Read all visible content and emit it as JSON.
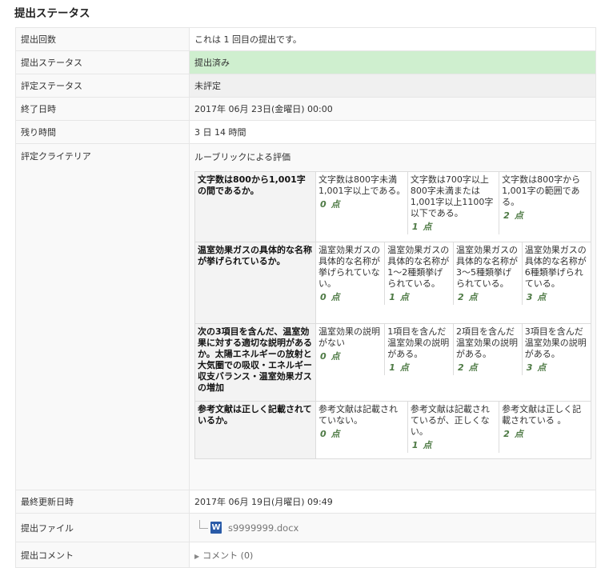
{
  "heading": "提出ステータス",
  "rows": {
    "attempt": {
      "label": "提出回数",
      "value": "これは 1 回目の提出です。"
    },
    "submission_status": {
      "label": "提出ステータス",
      "value": "提出済み"
    },
    "grading_status": {
      "label": "評定ステータス",
      "value": "未評定"
    },
    "due_date": {
      "label": "終了日時",
      "value": "2017年 06月 23日(金曜日) 00:00"
    },
    "time_remaining": {
      "label": "残り時間",
      "value": "3 日 14 時間"
    },
    "criteria": {
      "label": "評定クライテリア",
      "method": "ルーブリックによる評価"
    },
    "last_modified": {
      "label": "最終更新日時",
      "value": "2017年 06月 19日(月曜日) 09:49"
    },
    "files": {
      "label": "提出ファイル",
      "filename": "s9999999.docx"
    },
    "comments": {
      "label": "提出コメント",
      "toggle": "コメント (0)"
    }
  },
  "rubric": {
    "point_unit": "点",
    "criteria": [
      {
        "description": "文字数は800から1,001字の間であるか。",
        "levels": [
          {
            "definition": "文字数は800字未満1,001字以上である。",
            "score": "0"
          },
          {
            "definition": "文字数は700字以上800字未満または1,001字以上1100字以下である。",
            "score": "1"
          },
          {
            "definition": "文字数は800字から1,001字の範囲である。",
            "score": "2"
          }
        ]
      },
      {
        "description": "温室効果ガスの具体的な名称が挙げられているか。",
        "levels": [
          {
            "definition": "温室効果ガスの具体的な名称が挙げられていない。",
            "score": "0"
          },
          {
            "definition": "温室効果ガスの具体的な名称が1～2種類挙げられている。",
            "score": "1"
          },
          {
            "definition": "温室効果ガスの具体的な名称が3～5種類挙げられている。",
            "score": "2"
          },
          {
            "definition": "温室効果ガスの具体的な名称が6種類挙げられている。",
            "score": "3"
          }
        ]
      },
      {
        "description": "次の3項目を含んだ、温室効果に対する適切な説明があるか。太陽エネルギーの放射と大気圏での吸収・エネルギー収支バランス・温室効果ガスの増加",
        "levels": [
          {
            "definition": "温室効果の説明がない",
            "score": "0"
          },
          {
            "definition": "1項目を含んだ温室効果の説明がある。",
            "score": "1"
          },
          {
            "definition": "2項目を含んだ温室効果の説明がある。",
            "score": "2"
          },
          {
            "definition": "3項目を含んだ温室効果の説明がある。",
            "score": "3"
          }
        ]
      },
      {
        "description": "参考文献は正しく記載されているか。",
        "levels": [
          {
            "definition": "参考文献は記載されていない。",
            "score": "0"
          },
          {
            "definition": "参考文献は記載されているが、正しくない。",
            "score": "1"
          },
          {
            "definition": "参考文献は正しく記載されている 。",
            "score": "2"
          }
        ]
      }
    ]
  }
}
